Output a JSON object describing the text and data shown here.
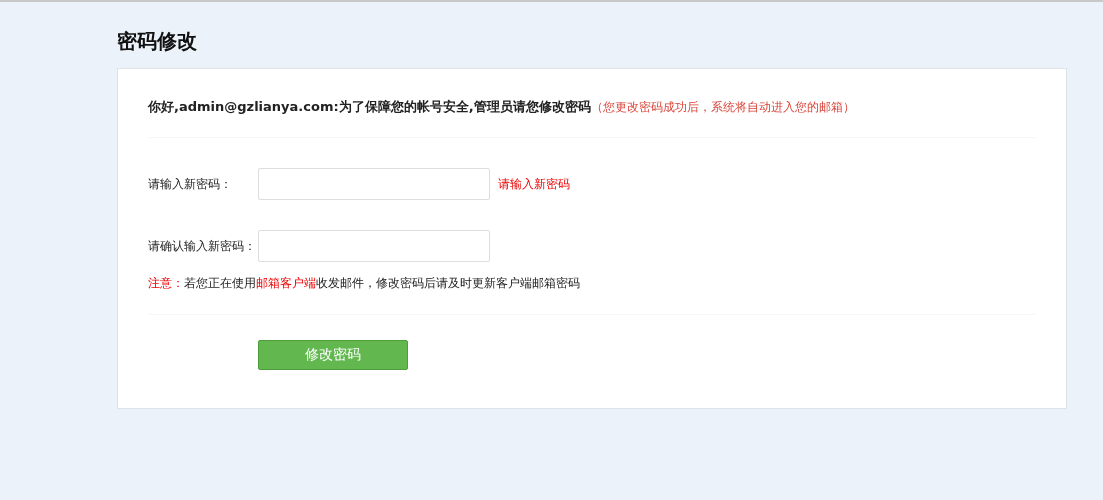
{
  "title": "密码修改",
  "greeting": "你好,admin@gzlianya.com:为了保障您的帐号安全,管理员请您修改密码",
  "greeting_hint": "（您更改密码成功后，系统将自动进入您的邮箱）",
  "fields": [
    {
      "label": "请输入新密码：",
      "error": "请输入新密码"
    },
    {
      "label": "请确认输入新密码："
    }
  ],
  "note": [
    {
      "text": "注意：",
      "highlight": true
    },
    {
      "text": "若您正在使用",
      "highlight": false
    },
    {
      "text": "邮箱客户端",
      "highlight": true
    },
    {
      "text": "收发邮件，修改密码后请及时更新客户端邮箱密码",
      "highlight": false
    }
  ],
  "submit": "修改密码"
}
